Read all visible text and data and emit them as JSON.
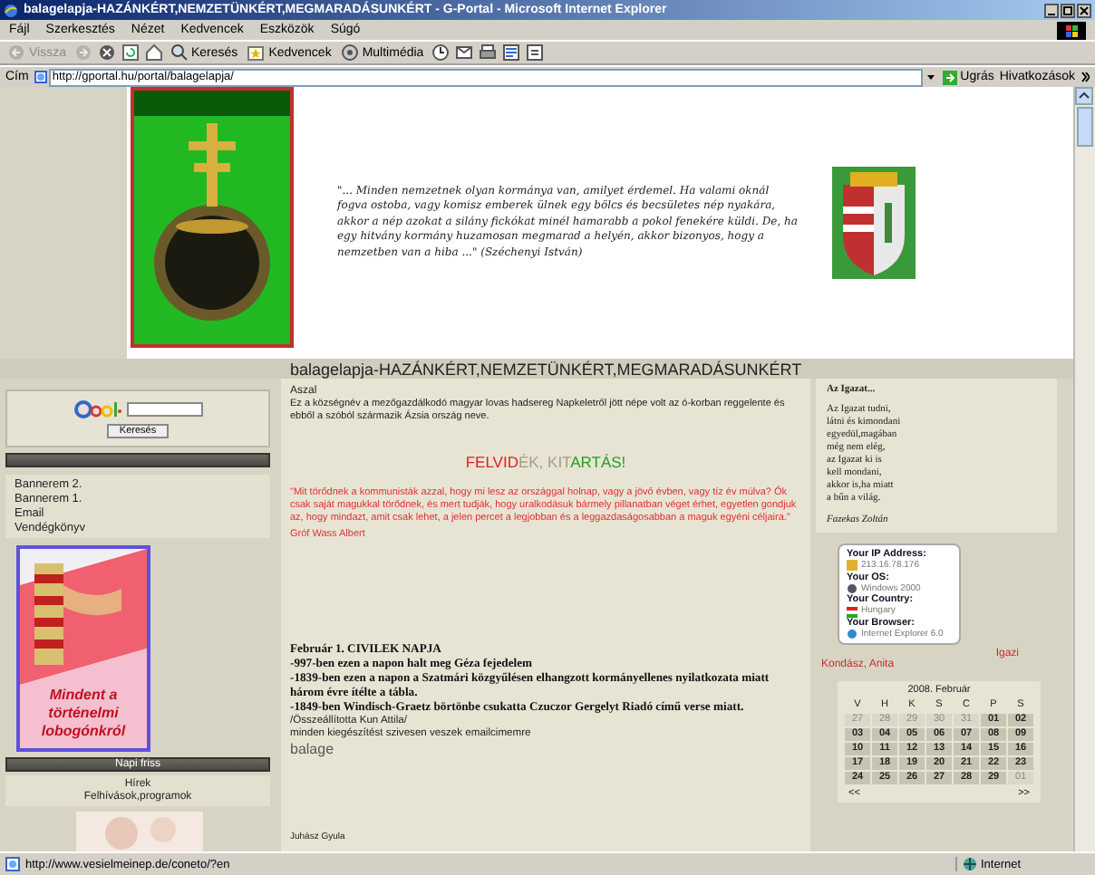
{
  "window": {
    "title": "balagelapja-HAZÁNKÉRT,NEMZETÜNKÉRT,MEGMARADÁSUNKÉRT - G-Portal - Microsoft Internet Explorer"
  },
  "menu": [
    "Fájl",
    "Szerkesztés",
    "Nézet",
    "Kedvencek",
    "Eszközök",
    "Súgó"
  ],
  "toolbar": [
    {
      "kind": "back",
      "label": "Vissza",
      "disabled": true
    },
    {
      "kind": "forward",
      "disabled": true
    },
    {
      "kind": "stop",
      "disabled": false
    },
    {
      "kind": "refresh",
      "disabled": false
    },
    {
      "kind": "home",
      "disabled": false
    },
    {
      "kind": "search",
      "label": "Keresés",
      "disabled": false
    },
    {
      "kind": "favorites",
      "label": "Kedvencek",
      "disabled": false
    },
    {
      "kind": "media",
      "label": "Multimédia",
      "disabled": false
    },
    {
      "kind": "history",
      "disabled": false
    },
    {
      "kind": "mail",
      "disabled": false
    },
    {
      "kind": "print",
      "disabled": false
    },
    {
      "kind": "edit",
      "disabled": false
    },
    {
      "kind": "discuss",
      "disabled": false
    }
  ],
  "address": {
    "label": "Cím",
    "value": "http://gportal.hu/portal/balagelapja/",
    "go": "Ugrás",
    "links": "Hivatkozások"
  },
  "header": {
    "quote": "\"... Minden nemzetnek olyan kormánya van, amilyet érdemel. Ha valami oknál fogva ostoba, vagy komisz emberek ülnek egy bölcs és becsületes nép nyakára, akkor a nép azokat a silány fickókat minél hamarabb a pokol fenekére küldi. De, ha egy hitvány kormány huzamosan megmarad a helyén, akkor bizonyos, hogy a nemzetben van a hiba ...\" (Széchenyi István)"
  },
  "page_title": "balagelapja-HAZÁNKÉRT,NEMZETÜNKÉRT,MEGMARADÁSUNKÉRT",
  "left": {
    "search_button": "Keresés",
    "links": [
      "Bannerem 2.",
      "Bannerem 1.",
      "Email",
      "Vendégkönyv"
    ],
    "banner_text": "Mindent a történelmi lobogónkról",
    "section_title": "Napi friss",
    "section_links": [
      "Hírek",
      "Felhívások,programok"
    ]
  },
  "main": {
    "heading": "Aszal",
    "intro": "Ez a községnév a mezőgazdálkodó magyar lovas hadsereg Napkeletről jött népe volt az ó-korban reggelente és ebből a szóból származik Ázsia ország neve.",
    "slogan": [
      {
        "text": "FELVID",
        "color": "#e02020"
      },
      {
        "text": "ÉK, ",
        "color": "#a39c84"
      },
      {
        "text": "KIT",
        "color": "#a39c84"
      },
      {
        "text": "ARTÁS!",
        "color": "#20a020"
      }
    ],
    "quote": "\"Mit törődnek a kommunisták azzal, hogy mi lesz az országgal holnap, vagy a jövő évben, vagy tíz év múlva? Ők csak saját magukkal törődnek, és mert tudják, hogy uralkodásuk bármely pillanatban véget érhet, egyetlen gondjuk az, hogy mindazt, amit csak lehet, a jelen percet a legjobban és a leggazdaságosabban a maguk egyéni céljaira.\"",
    "quote_author": "Gróf Wass Albert",
    "day_title": "Február 1.  CIVILEK NAPJA",
    "day_lines": [
      "-997-ben ezen a napon halt meg Géza fejedelem",
      "-1839-ben ezen a napon a Szatmári közgyűlésen elhangzott kormányellenes nyilatkozata miatt három évre ítélte a tábla.",
      "-1849-ben Windisch-Graetz börtönbe csukatta Czuczor Gergelyt Riadó című verse miatt."
    ],
    "compiled": "/Összeállította Kun Attila/",
    "note": "minden kiegészítést szivesen veszek emailcimemre",
    "signature": "balage",
    "footer": "Juhász Gyula"
  },
  "right": {
    "poem_title": "Az Igazat...",
    "poem_lines": [
      "Az Igazat tudni,",
      "látni és kimondani",
      "egyedül,magában",
      "még nem elég,",
      "az Igazat ki is",
      "kell mondani,",
      "akkor is,ha miatt",
      "a bűn a világ."
    ],
    "poem_author": "Fazekas Zoltán",
    "info": [
      {
        "label": "Your IP Address:",
        "value": "213.16.78.176",
        "kind": "ip"
      },
      {
        "label": "Your OS:",
        "value": "Windows 2000",
        "kind": "os"
      },
      {
        "label": "Your Country:",
        "value": "Hungary",
        "kind": "country"
      },
      {
        "label": "Your Browser:",
        "value": "Internet Explorer 6.0",
        "kind": "browser"
      }
    ],
    "extra_links": [
      "Igazi",
      "Kondász, Anita"
    ],
    "calendar": {
      "title": "2008. Február",
      "weekdays": [
        "V",
        "H",
        "K",
        "S",
        "C",
        "P",
        "S"
      ],
      "days": [
        {
          "label": "27",
          "other_month": true
        },
        {
          "label": "28",
          "other_month": true
        },
        {
          "label": "29",
          "other_month": true
        },
        {
          "label": "30",
          "other_month": true
        },
        {
          "label": "31",
          "other_month": true
        },
        {
          "label": "01",
          "other_month": false
        },
        {
          "label": "02",
          "other_month": false
        },
        {
          "label": "03",
          "other_month": false
        },
        {
          "label": "04",
          "other_month": false
        },
        {
          "label": "05",
          "other_month": false
        },
        {
          "label": "06",
          "other_month": false
        },
        {
          "label": "07",
          "other_month": false
        },
        {
          "label": "08",
          "other_month": false
        },
        {
          "label": "09",
          "other_month": false
        },
        {
          "label": "10",
          "other_month": false
        },
        {
          "label": "11",
          "other_month": false
        },
        {
          "label": "12",
          "other_month": false
        },
        {
          "label": "13",
          "other_month": false
        },
        {
          "label": "14",
          "other_month": false
        },
        {
          "label": "15",
          "other_month": false
        },
        {
          "label": "16",
          "other_month": false
        },
        {
          "label": "17",
          "other_month": false
        },
        {
          "label": "18",
          "other_month": false
        },
        {
          "label": "19",
          "other_month": false
        },
        {
          "label": "20",
          "other_month": false
        },
        {
          "label": "21",
          "other_month": false
        },
        {
          "label": "22",
          "other_month": false
        },
        {
          "label": "23",
          "other_month": false
        },
        {
          "label": "24",
          "other_month": false
        },
        {
          "label": "25",
          "other_month": false
        },
        {
          "label": "26",
          "other_month": false
        },
        {
          "label": "27",
          "other_month": false
        },
        {
          "label": "28",
          "other_month": false
        },
        {
          "label": "29",
          "other_month": false
        },
        {
          "label": "01",
          "other_month": true
        }
      ],
      "prev": "<<",
      "next": ">>"
    }
  },
  "status": {
    "url": "http://www.vesielmeinep.de/coneto/?en",
    "zone": "Internet"
  }
}
